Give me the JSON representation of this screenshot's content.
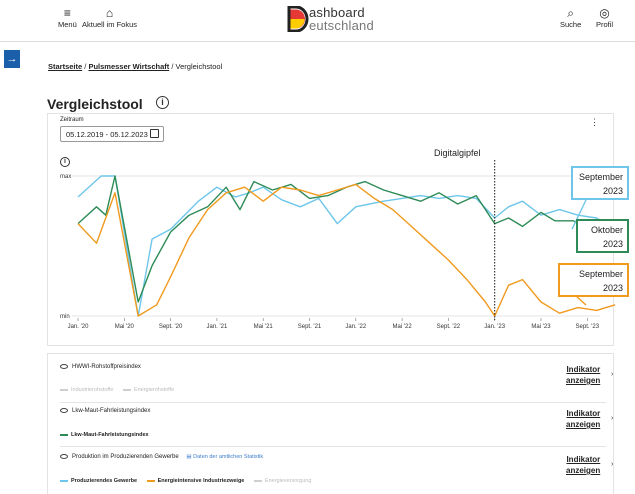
{
  "header": {
    "menu_label": "Menü",
    "focus_label": "Aktuell im Fokus",
    "logo_line1": "ashboard",
    "logo_line2": "eutschland",
    "search_label": "Suche",
    "profile_label": "Profil"
  },
  "breadcrumb": {
    "home": "Startseite",
    "sep1": " / ",
    "section": "Pulsmesser Wirtschaft",
    "sep2": " / ",
    "current": "Vergleichstool"
  },
  "page": {
    "title": "Vergleichstool"
  },
  "filter": {
    "label": "Zeitraum",
    "value": "05.12.2019 - 05.12.2023"
  },
  "annotations": {
    "digitalgipfel": "Digitalgipfel",
    "blue_line1": "September",
    "blue_line2": "2023",
    "green_line1": "Oktober",
    "green_line2": "2023",
    "orange_line1": "September",
    "orange_line2": "2023",
    "colors": {
      "blue": "#6ec6ea",
      "green": "#2e8b57",
      "orange": "#f09a1e"
    }
  },
  "chart_data": {
    "type": "line",
    "x": [
      "Jan. '20",
      "Mai '20",
      "Sept. '20",
      "Jan. '21",
      "Mai '21",
      "Sept. '21",
      "Jan. '22",
      "Mai '22",
      "Sept. '22",
      "Jan. '23",
      "Mai '23",
      "Sept. '23"
    ],
    "ytick_labels": [
      "min",
      "max"
    ],
    "ylim": [
      0,
      100
    ],
    "grid": "horizontal",
    "series": [
      {
        "color": "#6ec6ea",
        "points": [
          [
            0,
            85
          ],
          [
            0.5,
            100
          ],
          [
            0.8,
            100
          ],
          [
            1.3,
            0
          ],
          [
            1.6,
            55
          ],
          [
            2.0,
            62
          ],
          [
            2.6,
            82
          ],
          [
            3.0,
            92
          ],
          [
            3.4,
            85
          ],
          [
            3.7,
            88
          ],
          [
            4.0,
            92
          ],
          [
            4.4,
            83
          ],
          [
            4.8,
            78
          ],
          [
            5.2,
            84
          ],
          [
            5.6,
            66
          ],
          [
            6.0,
            78
          ],
          [
            6.6,
            82
          ],
          [
            7.0,
            84
          ],
          [
            7.4,
            86
          ],
          [
            7.8,
            84
          ],
          [
            8.2,
            86
          ],
          [
            8.6,
            84
          ],
          [
            9.0,
            70
          ],
          [
            9.3,
            78
          ],
          [
            9.6,
            82
          ],
          [
            10.0,
            72
          ],
          [
            10.4,
            76
          ],
          [
            10.8,
            72
          ],
          [
            11.2,
            70
          ],
          [
            11.6,
            62
          ]
        ]
      },
      {
        "color": "#2e8b57",
        "points": [
          [
            0,
            66
          ],
          [
            0.4,
            78
          ],
          [
            0.6,
            72
          ],
          [
            0.8,
            100
          ],
          [
            1.3,
            10
          ],
          [
            1.6,
            36
          ],
          [
            2.0,
            60
          ],
          [
            2.4,
            72
          ],
          [
            2.8,
            78
          ],
          [
            3.2,
            92
          ],
          [
            3.5,
            76
          ],
          [
            3.8,
            96
          ],
          [
            4.2,
            90
          ],
          [
            4.6,
            94
          ],
          [
            5.0,
            84
          ],
          [
            5.4,
            86
          ],
          [
            5.8,
            92
          ],
          [
            6.2,
            96
          ],
          [
            6.6,
            90
          ],
          [
            7.0,
            86
          ],
          [
            7.4,
            82
          ],
          [
            7.8,
            88
          ],
          [
            8.2,
            80
          ],
          [
            8.6,
            86
          ],
          [
            9.0,
            66
          ],
          [
            9.3,
            70
          ],
          [
            9.6,
            64
          ],
          [
            10.0,
            74
          ],
          [
            10.3,
            68
          ],
          [
            10.7,
            68
          ],
          [
            11.0,
            62
          ],
          [
            11.4,
            64
          ],
          [
            11.7,
            60
          ]
        ]
      },
      {
        "color": "#f09a1e",
        "points": [
          [
            0,
            66
          ],
          [
            0.4,
            52
          ],
          [
            0.8,
            88
          ],
          [
            1.3,
            0
          ],
          [
            1.7,
            8
          ],
          [
            2.0,
            28
          ],
          [
            2.4,
            56
          ],
          [
            2.8,
            76
          ],
          [
            3.2,
            88
          ],
          [
            3.6,
            92
          ],
          [
            4.0,
            82
          ],
          [
            4.4,
            92
          ],
          [
            4.8,
            90
          ],
          [
            5.2,
            86
          ],
          [
            5.6,
            90
          ],
          [
            6.0,
            94
          ],
          [
            6.4,
            84
          ],
          [
            6.8,
            76
          ],
          [
            7.2,
            64
          ],
          [
            7.6,
            52
          ],
          [
            8.0,
            40
          ],
          [
            8.4,
            26
          ],
          [
            8.8,
            10
          ],
          [
            9.0,
            0
          ],
          [
            9.3,
            22
          ],
          [
            9.6,
            26
          ],
          [
            10.0,
            10
          ],
          [
            10.4,
            2
          ],
          [
            10.8,
            6
          ],
          [
            11.2,
            4
          ],
          [
            11.6,
            8
          ]
        ]
      }
    ],
    "vline": {
      "x": 9.0,
      "label": "Digitalgipfel"
    }
  },
  "indicators": [
    {
      "title": "HWWI-Rohstoffpreisindex",
      "link_line1": "Indikator",
      "link_line2": "anzeigen",
      "legend": [
        {
          "label": "Industrierohstoffe",
          "color": "#cfcfcf",
          "muted": true
        },
        {
          "label": "Energierohstoffe",
          "color": "#cfcfcf",
          "muted": true
        }
      ]
    },
    {
      "title": "Lkw-Maut-Fahrleistungsindex",
      "link_line1": "Indikator",
      "link_line2": "anzeigen",
      "legend": [
        {
          "label": "Lkw-Maut-Fahrleistungsindex",
          "color": "#2e8b57",
          "muted": false
        }
      ]
    },
    {
      "title": "Produktion im Produzierenden Gewerbe",
      "extra_link": "Daten der amtlichen Statistik",
      "link_line1": "Indikator",
      "link_line2": "anzeigen",
      "legend": [
        {
          "label": "Produzierendes Gewerbe",
          "color": "#6ec6ea",
          "muted": false
        },
        {
          "label": "Energieintensive Industriezweige",
          "color": "#f09a1e",
          "muted": false
        },
        {
          "label": "Energieversorgung",
          "color": "#cfcfcf",
          "muted": true
        }
      ]
    }
  ]
}
